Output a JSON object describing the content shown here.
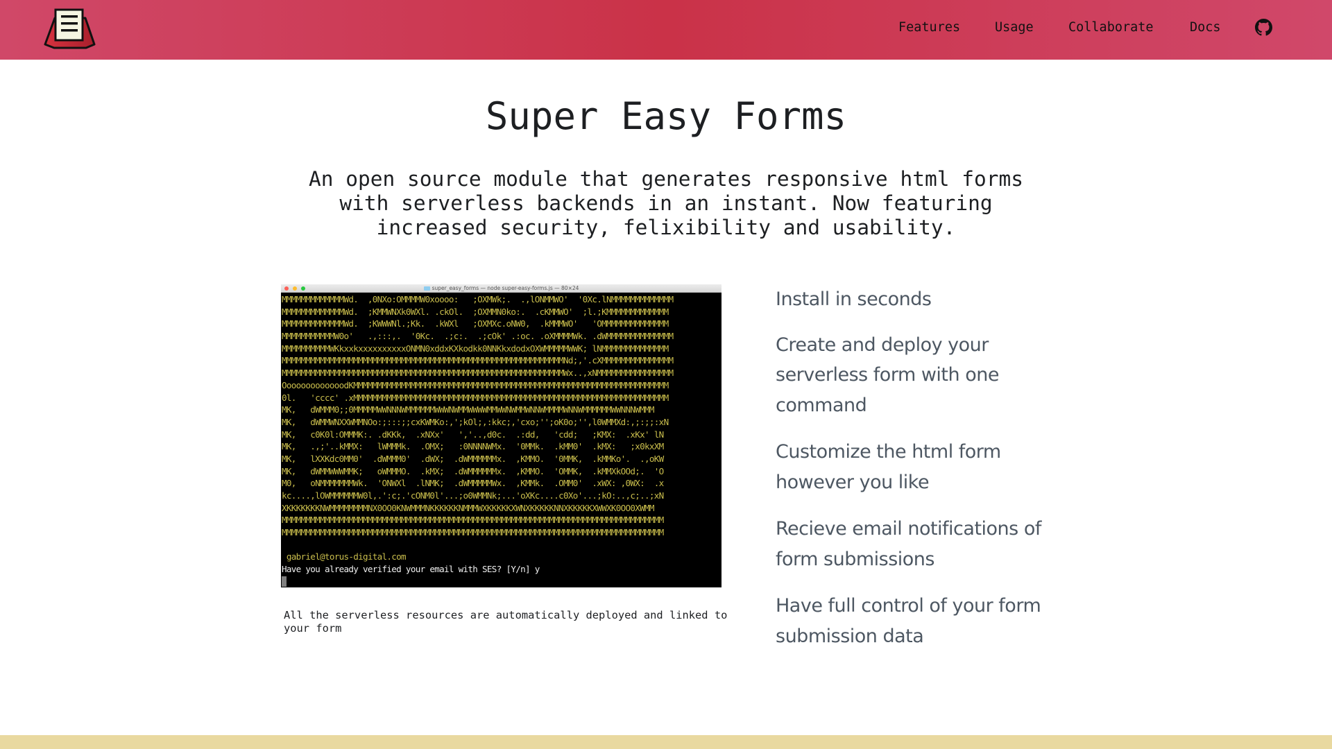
{
  "header": {
    "logo": "form-stand-logo",
    "nav": [
      {
        "label": "Features"
      },
      {
        "label": "Usage"
      },
      {
        "label": "Collaborate"
      },
      {
        "label": "Docs"
      }
    ],
    "github_icon": "github-icon",
    "colors": {
      "gradient_edge": "#d04868",
      "gradient_center": "#ca3248"
    }
  },
  "hero": {
    "title": "Super Easy Forms",
    "subtitle": "An open source module that generates responsive html forms with serverless backends in an instant. Now featuring increased security, felixibility and usability."
  },
  "terminal": {
    "window_title": "super_easy_forms — node super-easy-forms.js — 80×24",
    "lines": [
      "MMMMMMMMMMMMMWd.  ,0NXo:OMMMMW0xoooo:   ;OXMWk;.  .,lONMMWO'  '0Xc.lNMMMMMMMMMMMMM",
      "MMMMMMMMMMMMMWd.  ;KMMWNXk0WXl. .ckOl.  ;OXMMN0ko:.  .cKMMWO'  ;l.;KMMMMMMMMMMMMM",
      "MMMMMMMMMMMMMWd.  ;KWWWNl.;Kk.  .kWXl   ;OXMXc.oNW0,  .kMMMWO'   'OMMMMMMMMMMMMMM",
      "MMMMMMMMMMMW0o'   .,:::,.  '0Kc.  .;c:.  .;cOk' .:oc. .oXMMMMWk. .dWMMMMMMMMMMMMMM",
      "MMMMMMMMMMWKkxxkxxxxxxxxxxONMN0xddxKXkodkk0NNKkxdodxOXWMMMMMWWK; lNMMMMMMMMMMMMMM",
      "MMMMMMMMMMMMMMMMMMMMMMMMMMMMMMMMMMMMMMMMMMMMMMMMMMMMMMMMMMMNd;,'.cXMMMMMMMMMMMMMMM",
      "MMMMMMMMMMMMMMMMMMMMMMMMMMMMMMMMMMMMMMMMMMMMMMMMMMMMMMMMMMMWx..,xNMMMMMMMMMMMMMMMM",
      "OoooooooooooodKMMMMMMMMMMMMMMMMMMMMMMMMMMMMMMMMMMMMMMMMMMMMMMMMMMMMMMMMMMMMMMMMMM",
      "0l.   'cccc' .xMMMMMMMMMMMMMMMMMMMMMMMMMMMMMMMMMMMMMMMMMMMMMMMMMMMMMMMMMMMMMMMMMM",
      "MK,   dWMMM0;;0MMMMMWWNNNWMMMMMMWWWNWMMWWWWMMWWNWMMWNNWMMMMWNNWMMMMMMWWNNNWMMM",
      "MK,   dWMMWNXXWMMNOo:;:::;;cxKWMKo:,';kOl;,:kkc;,'cxo;'';oK0o;'',l0WMMXd:,;:;;:xN",
      "MK,   c0K0l:OMMMK:. .dKKk,  .xNXx'   ','..,d0c.  .:dd,   'cdd;   ;KMX:  .xKx' lN",
      "MK,   .,;'..kMMX:   lWMMMk.  .OMX;   :0NNNNWMx.  '0MMk.  .kMM0'  .kMX:   ;x0kxXM",
      "MK,   lXXKdc0MM0'  .dWMMM0'  .dWX;  .dWMMMMMMx.  ,KMMO.  '0MMK,  .kMMKo'.  .,oKW",
      "MK,   dWMMWWWMMK;   oWMMMO.  .kMX;  .dWMMMMMMx.  ,KMMO.  'OMMK,  .kMMXkOOd;.  'O",
      "M0,   oNMMMMMMMWk.  'ONWXl  .lNMK;  .dWMMMMMWx.  ,KMMk.  .OMM0'  .xWX: ,0WX:  .x",
      "kc....,lOWMMMMMMW0l,.':c;.'cONM0l'...;o0WMMNk;...'oXKc....c0Xo'...;kO:..,c;..;xN",
      "XKKKKKKKNWMMMMMMMMNX0OO0KNWMMMNKKKKKKNMMMWXKKKKKXWNXKKKKKNNXKKKKKXWWXK0OO0XWMM",
      "MMMMMMMMMMMMMMMMMMMMMMMMMMMMMMMMMMMMMMMMMMMMMMMMMMMMMMMMMMMMMMMMMMMMMMMMMMMMMMMM",
      "MMMMMMMMMMMMMMMMMMMMMMMMMMMMMMMMMMMMMMMMMMMMMMMMMMMMMMMMMMMMMMMMMMMMMMMMMMMMMMMM",
      "",
      " gabriel@torus-digital.com",
      "Have you already verified your email with SES? [Y/n] y"
    ],
    "colors": {
      "ascii": "#c9bd4c",
      "prompt": "#f0f0f0",
      "background": "#000000"
    }
  },
  "caption": "All the serverless resources are automatically deployed and linked to your form",
  "features": [
    "Install in seconds",
    "Create and deploy your serverless form with one command",
    "Customize the html form however you like",
    "Recieve email notifications of form submissions",
    "Have full control of your form submission data"
  ],
  "footer": {
    "band_color": "#e9d9a0"
  }
}
